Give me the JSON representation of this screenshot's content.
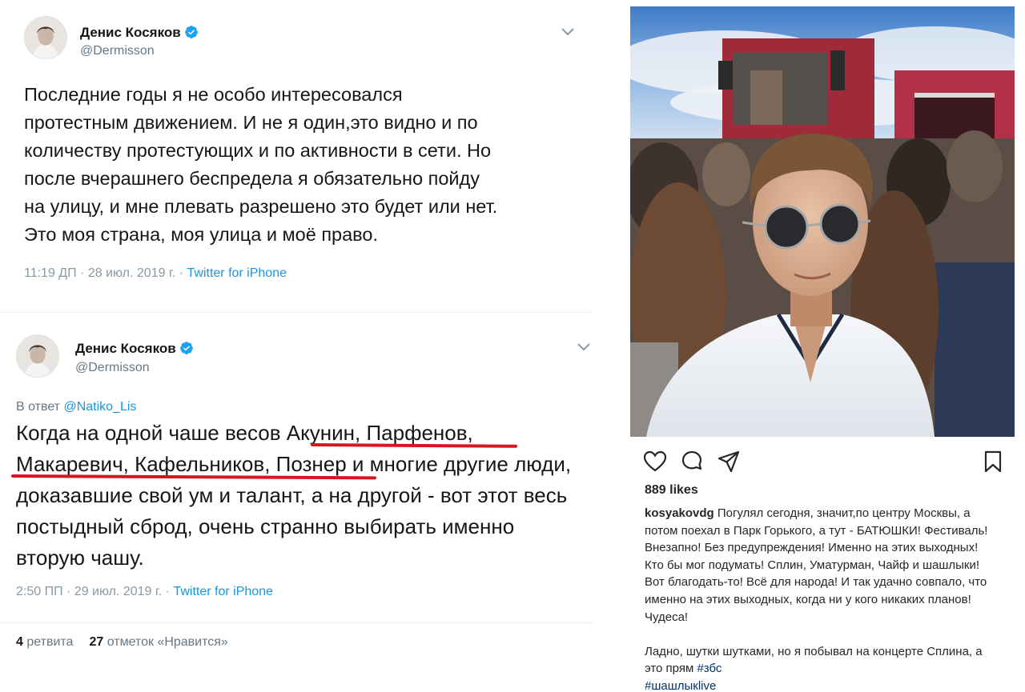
{
  "tweet1": {
    "author": "Денис Косяков",
    "handle": "@Dermisson",
    "text": "Последние годы я не особо интересовался\nпротестным движением. И не я один,это видно и по\nколичеству протестующих  и по активности в сети. Но\nпосле вчерашнего беспредела я обязательно пойду\nна улицу, и мне плевать разрешено это будет или нет.\nЭто моя страна, моя улица и моё право.",
    "time": "11:19 ДП · 28 июл. 2019 г. · ",
    "source": "Twitter for iPhone"
  },
  "tweet2": {
    "author": "Денис Косяков",
    "handle": "@Dermisson",
    "reply_prefix": "В ответ ",
    "reply_mention": "@Natiko_Lis",
    "text_part1": "Когда на одной чаше весов ",
    "text_hl1": "Акунин, Парфенов,",
    "text_part2": " ",
    "text_hl2": "Макаревич, Кафельников, Познер",
    "text_part3": " и многие другие люди, доказавшие свой ум и талант, а на другой - вот этот весь постыдный сброд, очень странно выбирать именно вторую чашу.",
    "time": "2:50 ПП · 29 июл. 2019 г. · ",
    "source": "Twitter for iPhone",
    "retweets_count": "4",
    "retweets_label": "ретвита",
    "likes_count": "27",
    "likes_label": "отметок «Нравится»"
  },
  "instagram": {
    "likes": "889 likes",
    "username": "kosyakovdg",
    "caption": " Погулял сегодня, значит,по центру Москвы, а потом поехал в Парк Горького, а тут - БАТЮШКИ! Фестиваль! Внезапно! Без предупреждения! Именно на этих выходных! Кто бы мог подумать! Сплин, Уматурман, Чайф и шашлыки! Вот благодать-то! Всё для народа! И так удачно совпало, что именно на этих выходных, когда ни у кого никаких планов! Чудеса!",
    "caption2": "Ладно, шутки шутками, но я побывал на концерте Сплина, а это прям ",
    "hashtag1": "#збс",
    "hashtag2": "#шашлыкlive"
  },
  "colors": {
    "link": "#1b95e0",
    "highlight_underline": "#d7151e",
    "ig_hashtag": "#003569"
  }
}
